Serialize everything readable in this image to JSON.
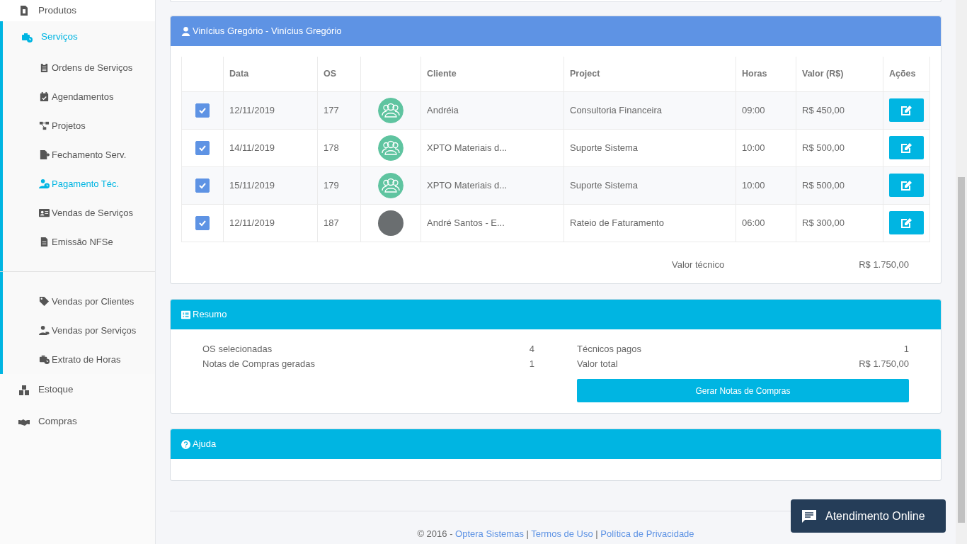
{
  "sidebar": {
    "items": [
      {
        "label": "Produtos",
        "selected": false,
        "expanded": false
      },
      {
        "label": "Serviços",
        "selected": true,
        "expanded": true,
        "groups": [
          {
            "children": [
              {
                "label": "Ordens de Serviços",
                "selected": false
              },
              {
                "label": "Agendamentos",
                "selected": false
              },
              {
                "label": "Projetos",
                "selected": false
              },
              {
                "label": "Fechamento Serv.",
                "selected": false
              },
              {
                "label": "Pagamento Téc.",
                "selected": true
              },
              {
                "label": "Vendas de Serviços",
                "selected": false
              },
              {
                "label": "Emissão NFSe",
                "selected": false
              }
            ]
          },
          {
            "children": [
              {
                "label": "Vendas por Clientes",
                "selected": false
              },
              {
                "label": "Vendas por Serviços",
                "selected": false
              },
              {
                "label": "Extrato de Horas",
                "selected": false
              }
            ]
          }
        ]
      },
      {
        "label": "Estoque",
        "selected": false,
        "expanded": false
      },
      {
        "label": "Compras",
        "selected": false,
        "expanded": false
      }
    ]
  },
  "technician_panel": {
    "title": "Vinícius Gregório - Vinícius Gregório",
    "table": {
      "columns": [
        "Data",
        "OS",
        "Cliente",
        "Project",
        "Horas",
        "Valor (R$)",
        "Ações"
      ],
      "rows": [
        {
          "checked": true,
          "date": "12/11/2019",
          "os": "177",
          "kind": "group",
          "client": "Andréia",
          "project": "Consultoria Financeira",
          "hours": "09:00",
          "value": "R$ 450,00"
        },
        {
          "checked": true,
          "date": "14/11/2019",
          "os": "178",
          "kind": "group",
          "client": "XPTO Materiais d...",
          "project": "Suporte Sistema",
          "hours": "10:00",
          "value": "R$ 500,00"
        },
        {
          "checked": true,
          "date": "15/11/2019",
          "os": "179",
          "kind": "group",
          "client": "XPTO Materiais d...",
          "project": "Suporte Sistema",
          "hours": "10:00",
          "value": "R$ 500,00"
        },
        {
          "checked": true,
          "date": "12/11/2019",
          "os": "187",
          "kind": "photo",
          "client": "André Santos - E...",
          "project": "Rateio de Faturamento",
          "hours": "06:00",
          "value": "R$ 300,00"
        }
      ]
    },
    "total_label": "Valor técnico",
    "total_value": "R$ 1.750,00"
  },
  "summary_panel": {
    "title": "Resumo",
    "left": [
      {
        "label": "OS selecionadas",
        "value": "4"
      },
      {
        "label": "Notas de Compras geradas",
        "value": "1"
      }
    ],
    "right": [
      {
        "label": "Técnicos pagos",
        "value": "1"
      },
      {
        "label": "Valor total",
        "value": "R$ 1.750,00"
      }
    ],
    "button": "Gerar Notas de Compras"
  },
  "help_panel": {
    "title": "Ajuda"
  },
  "footer": {
    "copyright": "© 2016 -",
    "links": [
      "Optera Sistemas",
      "Termos de Uso",
      "Política de Privacidade"
    ],
    "separator": "|"
  },
  "chat_button": "Atendimento Online"
}
